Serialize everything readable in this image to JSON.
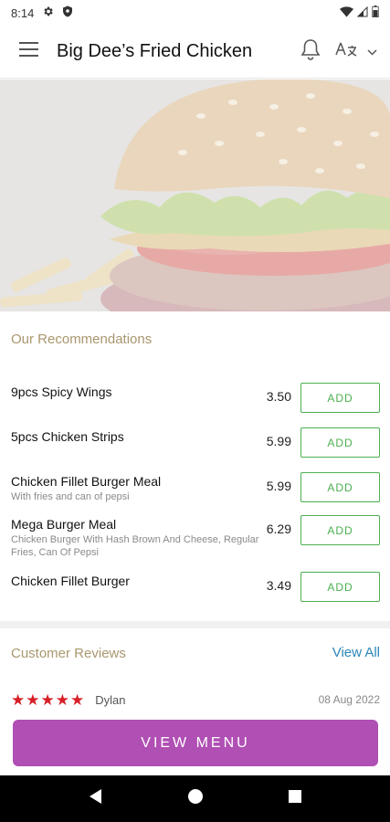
{
  "status_bar": {
    "time": "8:14"
  },
  "app_bar": {
    "title": "Big Dee’s Fried Chicken"
  },
  "recommendations": {
    "title": "Our Recommendations",
    "add_label": "ADD",
    "items": [
      {
        "name": "9pcs Spicy Wings",
        "description": "",
        "price": "3.50"
      },
      {
        "name": "5pcs Chicken Strips",
        "description": "",
        "price": "5.99"
      },
      {
        "name": "Chicken Fillet Burger Meal",
        "description": "With fries and can of pepsi",
        "price": "5.99"
      },
      {
        "name": "Mega Burger Meal",
        "description": "Chicken Burger With Hash Brown And Cheese, Regular Fries, Can Of Pepsi",
        "price": "6.29"
      },
      {
        "name": "Chicken Fillet Burger",
        "description": "",
        "price": "3.49"
      }
    ]
  },
  "reviews": {
    "title": "Customer Reviews",
    "view_all_label": "View All",
    "items": [
      {
        "rating": 5,
        "reviewer": "Dylan",
        "date": "08 Aug 2022"
      }
    ]
  },
  "view_menu_label": "VIEW MENU",
  "colors": {
    "accent_gold": "#a9976e",
    "add_green": "#4caf50",
    "view_all_blue": "#2b86b8",
    "star_red": "#d81f26",
    "view_menu_purple": "#b04fb4"
  }
}
